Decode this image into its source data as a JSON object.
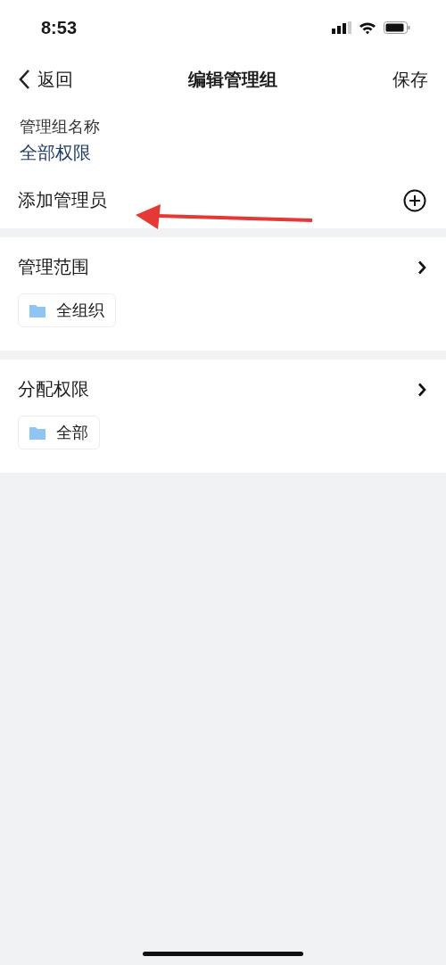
{
  "status_bar": {
    "time": "8:53"
  },
  "nav": {
    "back": "返回",
    "title": "编辑管理组",
    "action": "保存"
  },
  "group_name": {
    "label": "管理组名称",
    "value": "全部权限"
  },
  "add_admin": {
    "label": "添加管理员"
  },
  "sections": [
    {
      "title": "管理范围",
      "chips": [
        "全组织"
      ]
    },
    {
      "title": "分配权限",
      "chips": [
        "全部"
      ]
    }
  ]
}
